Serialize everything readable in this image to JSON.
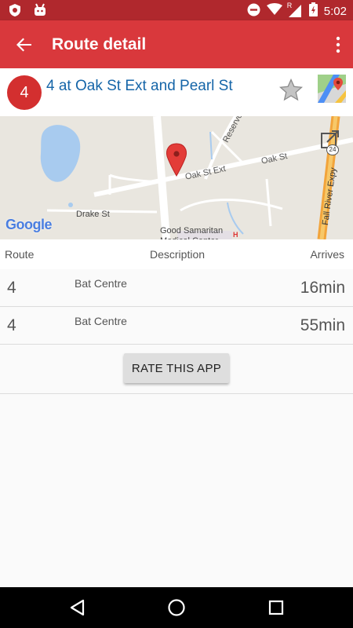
{
  "status_bar": {
    "time": "5:02",
    "network_label": "R"
  },
  "app_bar": {
    "title": "Route detail"
  },
  "stop": {
    "route_number": "4",
    "name": "4 at Oak St Ext and Pearl St"
  },
  "map": {
    "labels": {
      "reservoir": "Reservoir St",
      "oak_ext": "Oak St Ext",
      "oak": "Oak St",
      "drake": "Drake St",
      "fall_river": "Fall River Expy",
      "hospital": "Good Samaritan Medical Center",
      "hospital_marker": "H",
      "route_shield": "24",
      "google": "Google"
    }
  },
  "table": {
    "headers": {
      "route": "Route",
      "description": "Description",
      "arrives": "Arrives"
    },
    "rows": [
      {
        "route": "4",
        "description": "Bat Centre",
        "arrives": "16min"
      },
      {
        "route": "4",
        "description": "Bat Centre",
        "arrives": "55min"
      }
    ]
  },
  "rate_button": {
    "label": "RATE THIS APP"
  },
  "colors": {
    "app_bar": "#d9383c",
    "status_bar": "#b0282d",
    "route_badge": "#d32f2f",
    "stop_name": "#1565a8"
  }
}
